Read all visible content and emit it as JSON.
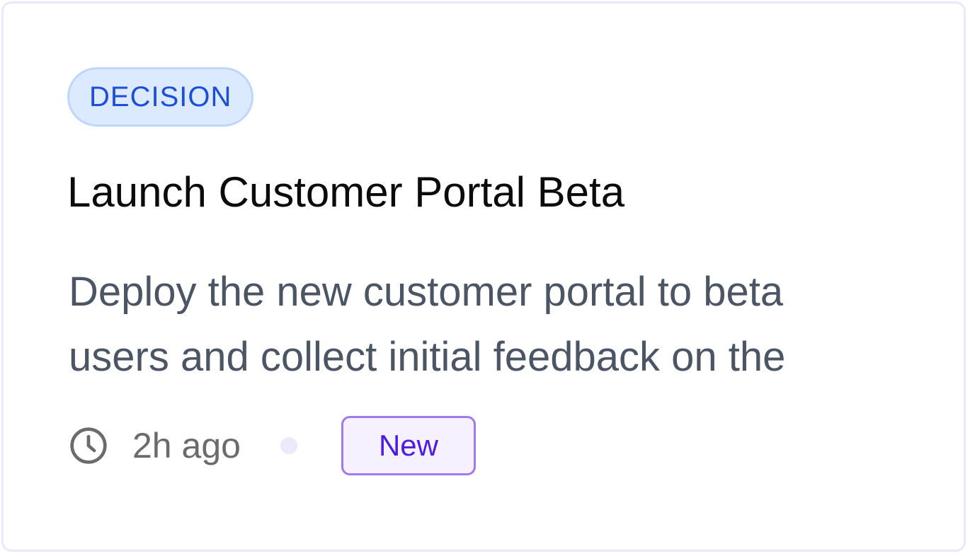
{
  "card": {
    "type_label": "DECISION",
    "title": "Launch Customer Portal Beta",
    "description_lines": [
      "Deploy the new customer portal to beta",
      "users and collect initial feedback on the"
    ],
    "time": "2h ago",
    "status_badge": "New",
    "icons": {
      "time": "clock-icon",
      "separator": "dot-separator"
    },
    "colors": {
      "type_badge_text": "#1d4ed8",
      "type_badge_bg": "#dbeafe",
      "status_badge_text": "#4c1de0",
      "status_badge_border": "#9f7aea"
    }
  }
}
